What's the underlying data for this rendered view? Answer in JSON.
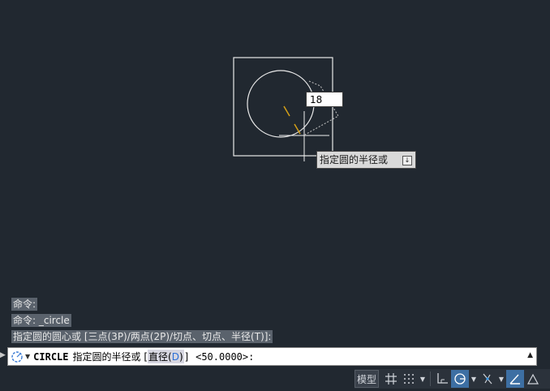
{
  "drawing": {
    "dynamic_input_value": "18",
    "prompt_tooltip": "指定圆的半径或"
  },
  "history": [
    "命令:",
    "命令: _circle",
    "指定圆的圆心或 [三点(3P)/两点(2P)/切点、切点、半径(T)]:"
  ],
  "command_line": {
    "command": "CIRCLE",
    "prompt": "指定圆的半径或 [",
    "option_text": "直径(",
    "option_key": "D",
    "option_close": ")",
    "tail": "] <50.0000>:"
  },
  "status_bar": {
    "model_label": "模型",
    "icons": [
      "grid-icon",
      "snap-dots-icon",
      "ortho-icon",
      "polar-icon",
      "osnap-track-icon",
      "annotation-icon"
    ]
  },
  "colors": {
    "background": "#212830",
    "geometry": "#ffffff",
    "accent": "#d4a017",
    "active": "#3d6fa3"
  }
}
